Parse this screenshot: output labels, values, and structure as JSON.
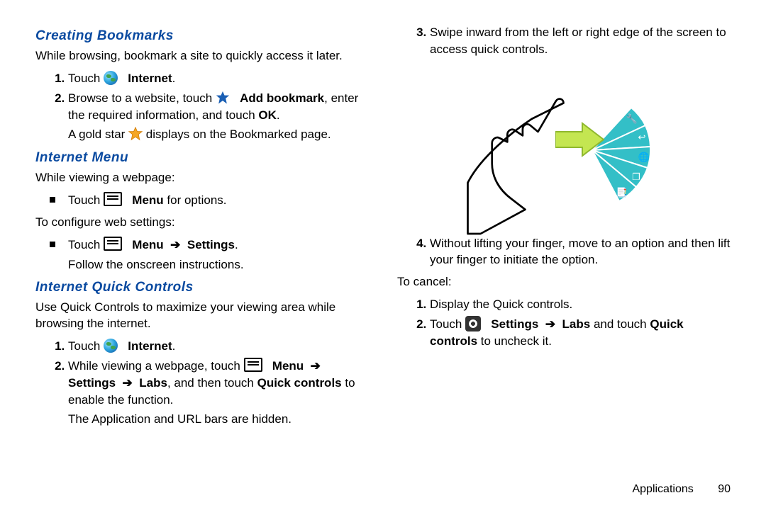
{
  "left": {
    "sec1": {
      "heading": "Creating Bookmarks",
      "intro": "While browsing, bookmark a site to quickly access it later.",
      "s1_a": "Touch ",
      "s1_b": "Internet",
      "s1_c": ".",
      "s2_a": "Browse to a website, touch ",
      "s2_b": "Add bookmark",
      "s2_c": ", enter the required information, and touch ",
      "s2_d": "OK",
      "s2_e": ".",
      "s2_note_a": "A gold star ",
      "s2_note_b": " displays on the Bookmarked page."
    },
    "sec2": {
      "heading": "Internet Menu",
      "l1": "While viewing a webpage:",
      "b1_a": "Touch ",
      "b1_b": "Menu",
      "b1_c": " for options.",
      "l2": "To configure web settings:",
      "b2_a": "Touch ",
      "b2_b": "Menu",
      "b2_c": "Settings",
      "b2_d": ".",
      "b2_follow": "Follow the onscreen instructions."
    },
    "sec3": {
      "heading": "Internet Quick Controls",
      "intro": "Use Quick Controls to maximize your viewing area while browsing the internet.",
      "s1_a": "Touch ",
      "s1_b": "Internet",
      "s1_c": ".",
      "s2_a": "While viewing a webpage, touch ",
      "s2_b": "Menu",
      "s2_c": "Settings",
      "s2_d": "Labs",
      "s2_e": ", and then touch ",
      "s2_f": "Quick controls",
      "s2_g": " to enable the function.",
      "s2_note": "The Application and URL bars are hidden."
    }
  },
  "right": {
    "s3": "Swipe inward from the left or right edge of the screen to access quick controls.",
    "s4": "Without lifting your finger, move to an option and then lift your finger to initiate the option.",
    "cancel_label": "To cancel:",
    "c1": "Display the Quick controls.",
    "c2_a": "Touch ",
    "c2_b": "Settings",
    "c2_c": "Labs",
    "c2_d": " and touch ",
    "c2_e": "Quick controls",
    "c2_f": " to uncheck it."
  },
  "footer": {
    "section": "Applications",
    "page": "90"
  },
  "arrow_glyph": "➔"
}
